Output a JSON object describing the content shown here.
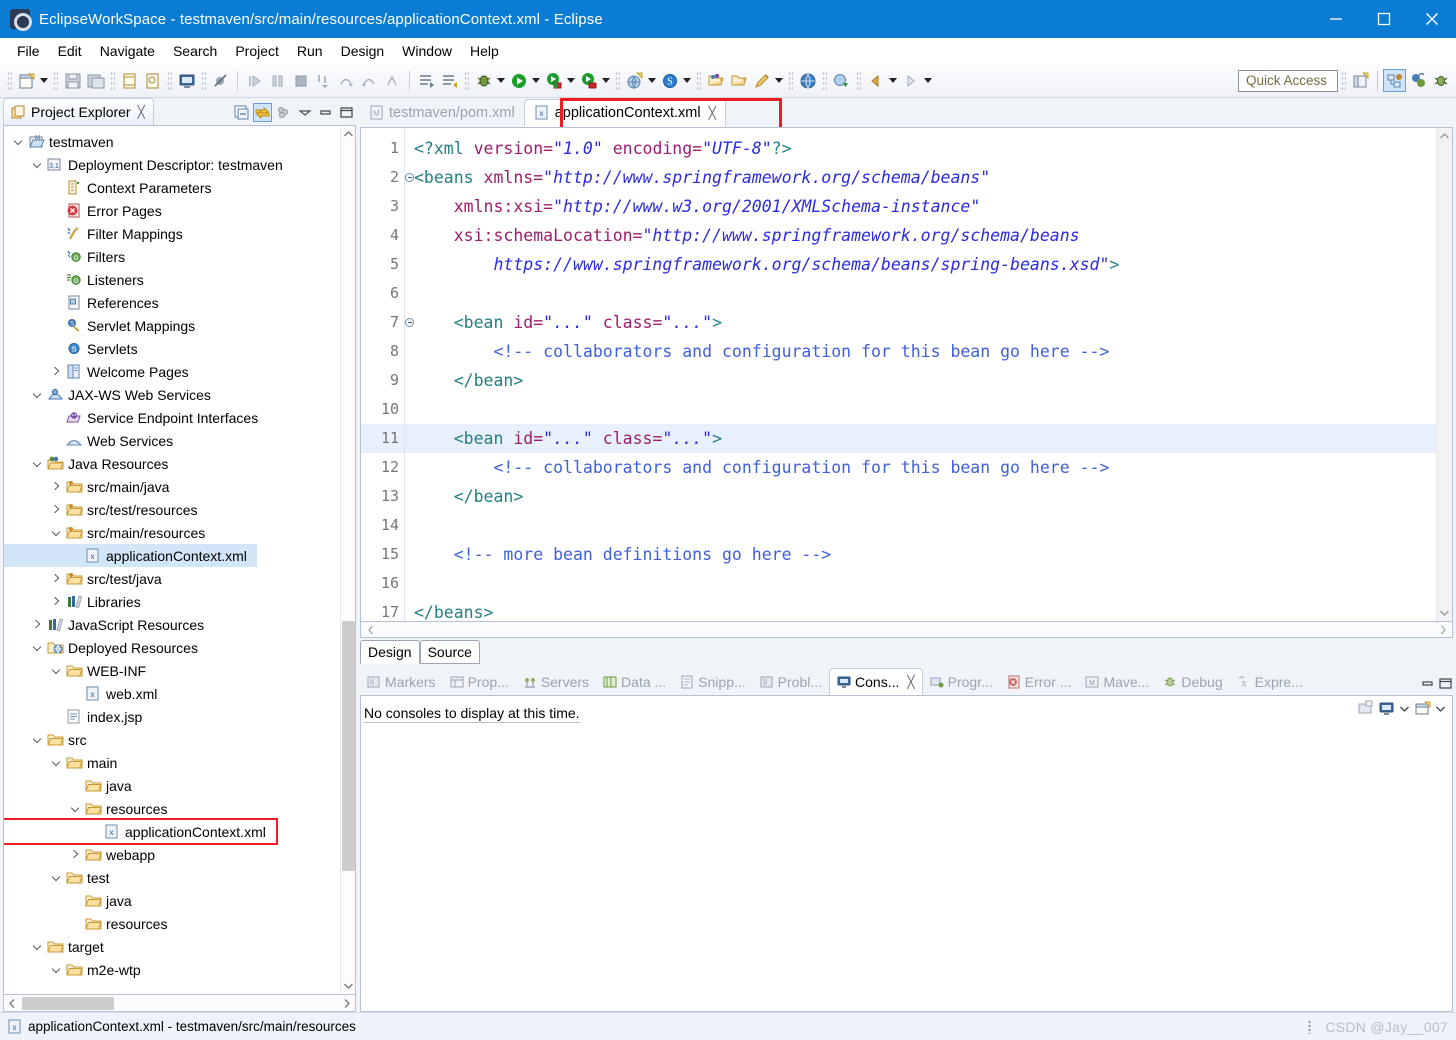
{
  "window": {
    "title": "EclipseWorkSpace - testmaven/src/main/resources/applicationContext.xml - Eclipse",
    "minimize_label": "Minimize",
    "maximize_label": "Maximize",
    "close_label": "Close",
    "accent_color": "#0a7cd4"
  },
  "menu": {
    "items": [
      "File",
      "Edit",
      "Navigate",
      "Search",
      "Project",
      "Run",
      "Design",
      "Window",
      "Help"
    ]
  },
  "toolbar": {
    "quick_access_placeholder": "Quick Access",
    "buttons": [
      "new-wizard-icon",
      "save-icon",
      "save-all-icon",
      "print-icon",
      "quick-outline-icon",
      "console-icon",
      "skip-breakpoints-icon",
      "resume-icon",
      "suspend-icon",
      "terminate-icon",
      "step-into-icon",
      "step-over-icon",
      "step-return-icon",
      "drop-to-frame-icon",
      "next-annotation-icon",
      "previous-annotation-icon",
      "debug-icon",
      "run-icon",
      "run-as-icon",
      "coverage-icon",
      "new-server-icon",
      "search-icon",
      "open-type-icon",
      "open-task-icon",
      "pencil-icon",
      "web-browser-icon",
      "deploy-icon",
      "back-icon",
      "forward-icon"
    ],
    "perspective_buttons": [
      "open-perspective-icon",
      "java-ee-perspective-icon",
      "java-perspective-icon",
      "debug-perspective-icon"
    ]
  },
  "project_explorer": {
    "title": "Project Explorer",
    "close_label": "╳",
    "toolbar": [
      "collapse-all-icon",
      "link-with-editor-icon",
      "view-menu-icon",
      "minimize-icon",
      "maximize-icon"
    ],
    "tree": [
      {
        "label": "testmaven",
        "depth": 0,
        "twisty": "down",
        "icon": "maven-project-icon"
      },
      {
        "label": "Deployment Descriptor: testmaven",
        "depth": 1,
        "twisty": "down",
        "icon": "deployment-descriptor-icon"
      },
      {
        "label": "Context Parameters",
        "depth": 2,
        "twisty": "none",
        "icon": "context-parameters-icon"
      },
      {
        "label": "Error Pages",
        "depth": 2,
        "twisty": "none",
        "icon": "error-pages-icon"
      },
      {
        "label": "Filter Mappings",
        "depth": 2,
        "twisty": "none",
        "icon": "filter-mappings-icon"
      },
      {
        "label": "Filters",
        "depth": 2,
        "twisty": "none",
        "icon": "filters-icon"
      },
      {
        "label": "Listeners",
        "depth": 2,
        "twisty": "none",
        "icon": "listeners-icon"
      },
      {
        "label": "References",
        "depth": 2,
        "twisty": "none",
        "icon": "references-icon"
      },
      {
        "label": "Servlet Mappings",
        "depth": 2,
        "twisty": "none",
        "icon": "servlet-mappings-icon"
      },
      {
        "label": "Servlets",
        "depth": 2,
        "twisty": "none",
        "icon": "servlets-icon"
      },
      {
        "label": "Welcome Pages",
        "depth": 2,
        "twisty": "right",
        "icon": "welcome-pages-icon"
      },
      {
        "label": "JAX-WS Web Services",
        "depth": 1,
        "twisty": "down",
        "icon": "jaxws-icon"
      },
      {
        "label": "Service Endpoint Interfaces",
        "depth": 2,
        "twisty": "none",
        "icon": "endpoint-icon"
      },
      {
        "label": "Web Services",
        "depth": 2,
        "twisty": "none",
        "icon": "web-services-icon"
      },
      {
        "label": "Java Resources",
        "depth": 1,
        "twisty": "down",
        "icon": "java-resources-icon"
      },
      {
        "label": "src/main/java",
        "depth": 2,
        "twisty": "right",
        "icon": "source-folder-icon"
      },
      {
        "label": "src/test/resources",
        "depth": 2,
        "twisty": "right",
        "icon": "source-folder-icon"
      },
      {
        "label": "src/main/resources",
        "depth": 2,
        "twisty": "down",
        "icon": "source-folder-icon"
      },
      {
        "label": "applicationContext.xml",
        "depth": 3,
        "twisty": "none",
        "icon": "xml-file-icon",
        "selected": true
      },
      {
        "label": "src/test/java",
        "depth": 2,
        "twisty": "right",
        "icon": "source-folder-icon"
      },
      {
        "label": "Libraries",
        "depth": 2,
        "twisty": "right",
        "icon": "libraries-icon"
      },
      {
        "label": "JavaScript Resources",
        "depth": 1,
        "twisty": "right",
        "icon": "libraries-icon"
      },
      {
        "label": "Deployed Resources",
        "depth": 1,
        "twisty": "down",
        "icon": "deployed-resources-icon"
      },
      {
        "label": "WEB-INF",
        "depth": 2,
        "twisty": "down",
        "icon": "folder-icon"
      },
      {
        "label": "web.xml",
        "depth": 3,
        "twisty": "none",
        "icon": "xml-file-icon"
      },
      {
        "label": "index.jsp",
        "depth": 2,
        "twisty": "none",
        "icon": "jsp-file-icon"
      },
      {
        "label": "src",
        "depth": 1,
        "twisty": "down",
        "icon": "folder-icon"
      },
      {
        "label": "main",
        "depth": 2,
        "twisty": "down",
        "icon": "folder-icon"
      },
      {
        "label": "java",
        "depth": 3,
        "twisty": "none",
        "icon": "folder-icon"
      },
      {
        "label": "resources",
        "depth": 3,
        "twisty": "down",
        "icon": "folder-icon"
      },
      {
        "label": "applicationContext.xml",
        "depth": 4,
        "twisty": "none",
        "icon": "xml-file-icon",
        "redbox": true
      },
      {
        "label": "webapp",
        "depth": 3,
        "twisty": "right",
        "icon": "folder-icon"
      },
      {
        "label": "test",
        "depth": 2,
        "twisty": "down",
        "icon": "folder-icon"
      },
      {
        "label": "java",
        "depth": 3,
        "twisty": "none",
        "icon": "folder-icon"
      },
      {
        "label": "resources",
        "depth": 3,
        "twisty": "none",
        "icon": "folder-icon"
      },
      {
        "label": "target",
        "depth": 1,
        "twisty": "down",
        "icon": "folder-icon"
      },
      {
        "label": "m2e-wtp",
        "depth": 2,
        "twisty": "down",
        "icon": "folder-icon"
      }
    ]
  },
  "editor": {
    "tabs": [
      {
        "label": "testmaven/pom.xml",
        "icon": "maven-file-icon",
        "active": false,
        "closable": false
      },
      {
        "label": "applicationContext.xml",
        "icon": "xml-file-icon",
        "active": true,
        "closable": true,
        "highlighted": true
      }
    ],
    "close_glyph": "╳",
    "page_tabs": [
      {
        "label": "Design",
        "active": true
      },
      {
        "label": "Source",
        "active": false
      }
    ],
    "current_line": 11,
    "lines": [
      {
        "n": 1,
        "fold": false,
        "segments": [
          {
            "t": "<?xml ",
            "c": "pi"
          },
          {
            "t": "version=",
            "c": "attr"
          },
          {
            "t": "\"1.0\"",
            "c": "val"
          },
          {
            "t": " ",
            "c": "plain"
          },
          {
            "t": "encoding=",
            "c": "attr"
          },
          {
            "t": "\"UTF-8\"",
            "c": "val"
          },
          {
            "t": "?>",
            "c": "pi"
          }
        ]
      },
      {
        "n": 2,
        "fold": true,
        "segments": [
          {
            "t": "<beans ",
            "c": "tag"
          },
          {
            "t": "xmlns=",
            "c": "attr"
          },
          {
            "t": "\"http://www.springframework.org/schema/beans\"",
            "c": "val"
          }
        ]
      },
      {
        "n": 3,
        "fold": false,
        "segments": [
          {
            "t": "    ",
            "c": "plain"
          },
          {
            "t": "xmlns:xsi=",
            "c": "attr"
          },
          {
            "t": "\"http://www.w3.org/2001/XMLSchema-instance\"",
            "c": "val"
          }
        ]
      },
      {
        "n": 4,
        "fold": false,
        "segments": [
          {
            "t": "    ",
            "c": "plain"
          },
          {
            "t": "xsi:schemaLocation=",
            "c": "attr"
          },
          {
            "t": "\"http://www.springframework.org/schema/beans",
            "c": "val"
          }
        ]
      },
      {
        "n": 5,
        "fold": false,
        "segments": [
          {
            "t": "        ",
            "c": "plain"
          },
          {
            "t": "https://www.springframework.org/schema/beans/spring-beans.xsd\"",
            "c": "val"
          },
          {
            "t": ">",
            "c": "tag"
          }
        ]
      },
      {
        "n": 6,
        "fold": false,
        "segments": []
      },
      {
        "n": 7,
        "fold": true,
        "segments": [
          {
            "t": "    ",
            "c": "plain"
          },
          {
            "t": "<bean ",
            "c": "tag"
          },
          {
            "t": "id=",
            "c": "attr"
          },
          {
            "t": "\"...\"",
            "c": "val"
          },
          {
            "t": " ",
            "c": "plain"
          },
          {
            "t": "class=",
            "c": "attr"
          },
          {
            "t": "\"...\"",
            "c": "val"
          },
          {
            "t": ">",
            "c": "tag"
          }
        ]
      },
      {
        "n": 8,
        "fold": false,
        "segments": [
          {
            "t": "        ",
            "c": "plain"
          },
          {
            "t": "<!-- collaborators and configuration for this bean go here -->",
            "c": "com"
          }
        ]
      },
      {
        "n": 9,
        "fold": false,
        "segments": [
          {
            "t": "    ",
            "c": "plain"
          },
          {
            "t": "</bean>",
            "c": "tag"
          }
        ]
      },
      {
        "n": 10,
        "fold": false,
        "segments": []
      },
      {
        "n": 11,
        "fold": true,
        "current": true,
        "caret": true,
        "segments": [
          {
            "t": "    ",
            "c": "plain"
          },
          {
            "t": "<bean ",
            "c": "tag"
          },
          {
            "t": "id=",
            "c": "attr"
          },
          {
            "t": "\"...\"",
            "c": "val"
          },
          {
            "t": " ",
            "c": "plain"
          },
          {
            "t": "class=",
            "c": "attr"
          },
          {
            "t": "\"...\"",
            "c": "val"
          },
          {
            "t": ">",
            "c": "tag"
          }
        ]
      },
      {
        "n": 12,
        "fold": false,
        "segments": [
          {
            "t": "        ",
            "c": "plain"
          },
          {
            "t": "<!-- collaborators and configuration for this bean go here -->",
            "c": "com"
          }
        ]
      },
      {
        "n": 13,
        "fold": false,
        "segments": [
          {
            "t": "    ",
            "c": "plain"
          },
          {
            "t": "</bean>",
            "c": "tag"
          }
        ]
      },
      {
        "n": 14,
        "fold": false,
        "segments": []
      },
      {
        "n": 15,
        "fold": false,
        "segments": [
          {
            "t": "    ",
            "c": "plain"
          },
          {
            "t": "<!-- more bean definitions go here -->",
            "c": "com"
          }
        ]
      },
      {
        "n": 16,
        "fold": false,
        "segments": []
      },
      {
        "n": 17,
        "fold": false,
        "segments": [
          {
            "t": "</beans>",
            "c": "tag"
          }
        ]
      }
    ]
  },
  "console_panel": {
    "tabs": [
      {
        "label": "Markers",
        "icon": "markers-icon",
        "active": false
      },
      {
        "label": "Prop...",
        "icon": "properties-icon",
        "active": false
      },
      {
        "label": "Servers",
        "icon": "servers-icon",
        "active": false
      },
      {
        "label": "Data ...",
        "icon": "data-source-icon",
        "active": false
      },
      {
        "label": "Snipp...",
        "icon": "snippets-icon",
        "active": false
      },
      {
        "label": "Probl...",
        "icon": "problems-icon",
        "active": false
      },
      {
        "label": "Cons...",
        "icon": "console-icon",
        "active": true
      },
      {
        "label": "Progr...",
        "icon": "progress-icon",
        "active": false
      },
      {
        "label": "Error ...",
        "icon": "error-log-icon",
        "active": false
      },
      {
        "label": "Mave...",
        "icon": "maven-icon",
        "active": false
      },
      {
        "label": "Debug",
        "icon": "debug-icon",
        "active": false
      },
      {
        "label": "Expre...",
        "icon": "expressions-icon",
        "active": false
      }
    ],
    "close_glyph": "╳",
    "empty_message": "No consoles to display at this time.",
    "toolbar": [
      "open-console-icon",
      "display-selected-console-icon",
      "new-console-view-icon"
    ],
    "frame_buttons": [
      "minimize-icon",
      "maximize-icon"
    ]
  },
  "status_bar": {
    "text": "applicationContext.xml - testmaven/src/main/resources",
    "icon": "xml-file-icon",
    "watermark": "CSDN @Jay__007"
  }
}
